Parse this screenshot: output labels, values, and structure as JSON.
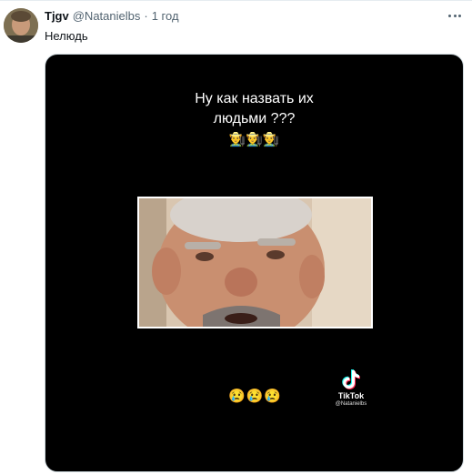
{
  "tweet": {
    "display_name": "Tjgv",
    "handle": "@Natanielbs",
    "separator": "·",
    "time": "1 год",
    "text": "Нелюдь"
  },
  "media": {
    "caption_line1": "Ну как назвать их",
    "caption_line2": "людьми ???",
    "caption_emojis": "👨‍🌾👨‍🌾👨‍🌾",
    "bottom_emojis": "😢😢😢",
    "watermark": {
      "name": "TikTok",
      "username": "@Natanielbs"
    }
  },
  "icons": {
    "more": "more-horizontal-icon",
    "tiktok": "tiktok-logo-icon"
  },
  "colors": {
    "text_primary": "#0f1419",
    "text_secondary": "#536471",
    "media_background": "#000000"
  }
}
